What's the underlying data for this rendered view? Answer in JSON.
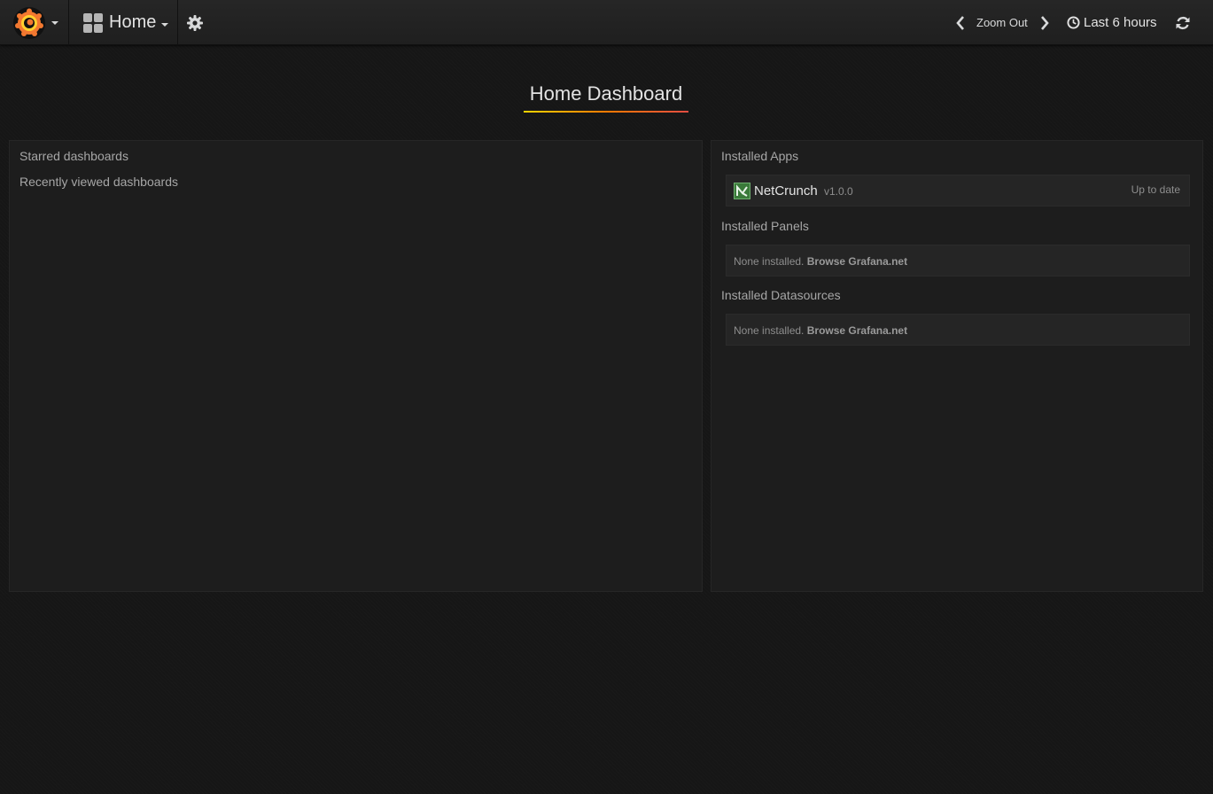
{
  "navbar": {
    "home_label": "Home",
    "zoom_label": "Zoom Out",
    "time_range_label": "Last 6 hours"
  },
  "page": {
    "title": "Home Dashboard"
  },
  "left_panel": {
    "starred_heading": "Starred dashboards",
    "recent_heading": "Recently viewed dashboards"
  },
  "right_panel": {
    "apps_heading": "Installed Apps",
    "apps": [
      {
        "name": "NetCrunch",
        "version": "v1.0.0",
        "status": "Up to date"
      }
    ],
    "panels_heading": "Installed Panels",
    "panels_empty": "None installed.",
    "panels_link": "Browse Grafana.net",
    "datasources_heading": "Installed Datasources",
    "datasources_empty": "None installed.",
    "datasources_link": "Browse Grafana.net"
  },
  "colors": {
    "background": "#161616",
    "panel": "#1d1d1d",
    "logo_orange": "#f05a28",
    "title_underline_start": "#ffd500",
    "title_underline_end": "#e24d42"
  },
  "icons": {
    "logo": "grafana-logo-icon",
    "dashboards": "dashboard-grid-icon",
    "settings": "gear-icon",
    "zoom_prev": "chevron-left-icon",
    "zoom_next": "chevron-right-icon",
    "time": "clock-icon",
    "refresh": "refresh-icon",
    "app": "netcrunch-app-icon"
  }
}
